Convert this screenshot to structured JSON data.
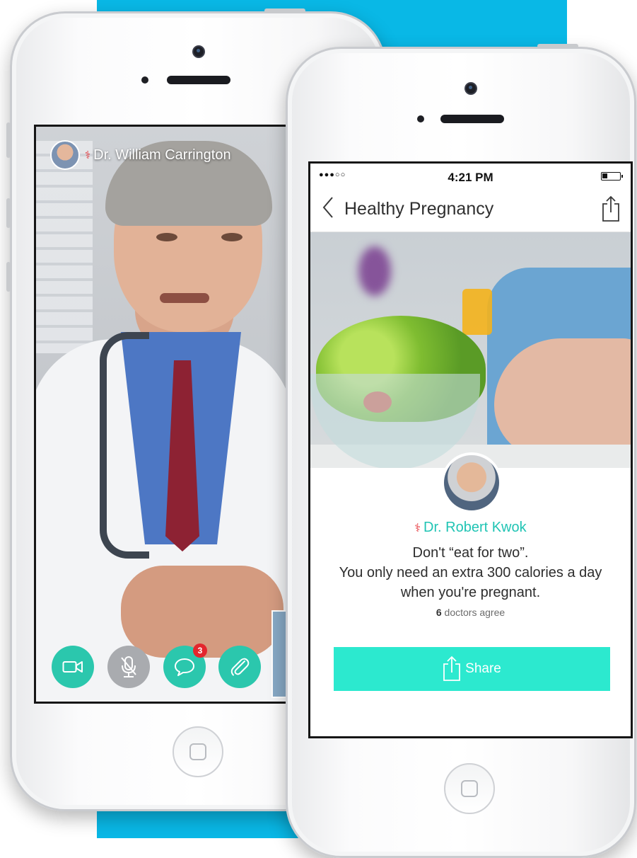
{
  "colors": {
    "background_band": "#09b8e6",
    "call_button_teal": "#2bc7ad",
    "call_button_grey": "#a9abaf",
    "badge_red": "#e3262d",
    "doctor_name_teal": "#20c4b4",
    "share_button": "#2ce9cf"
  },
  "video_call": {
    "doctor_name": "Dr. William Carrington",
    "controls": [
      {
        "name": "video",
        "icon": "video-camera-icon"
      },
      {
        "name": "mute",
        "icon": "microphone-muted-icon"
      },
      {
        "name": "chat",
        "icon": "chat-bubble-icon",
        "badge": "3"
      },
      {
        "name": "attach",
        "icon": "paperclip-icon"
      }
    ]
  },
  "article": {
    "status_bar": {
      "signal": "●●●○○",
      "time": "4:21 PM"
    },
    "nav": {
      "back_icon": "chevron-left-icon",
      "title": "Healthy Pregnancy",
      "share_icon": "share-icon"
    },
    "author": "Dr. Robert Kwok",
    "quote_line1": "Don't “eat for two”.",
    "quote_line2": "You only need an extra 300 calories a day",
    "quote_line3": "when you're pregnant.",
    "agree_count": "6",
    "agree_text": "doctors agree",
    "share_label": "Share"
  }
}
